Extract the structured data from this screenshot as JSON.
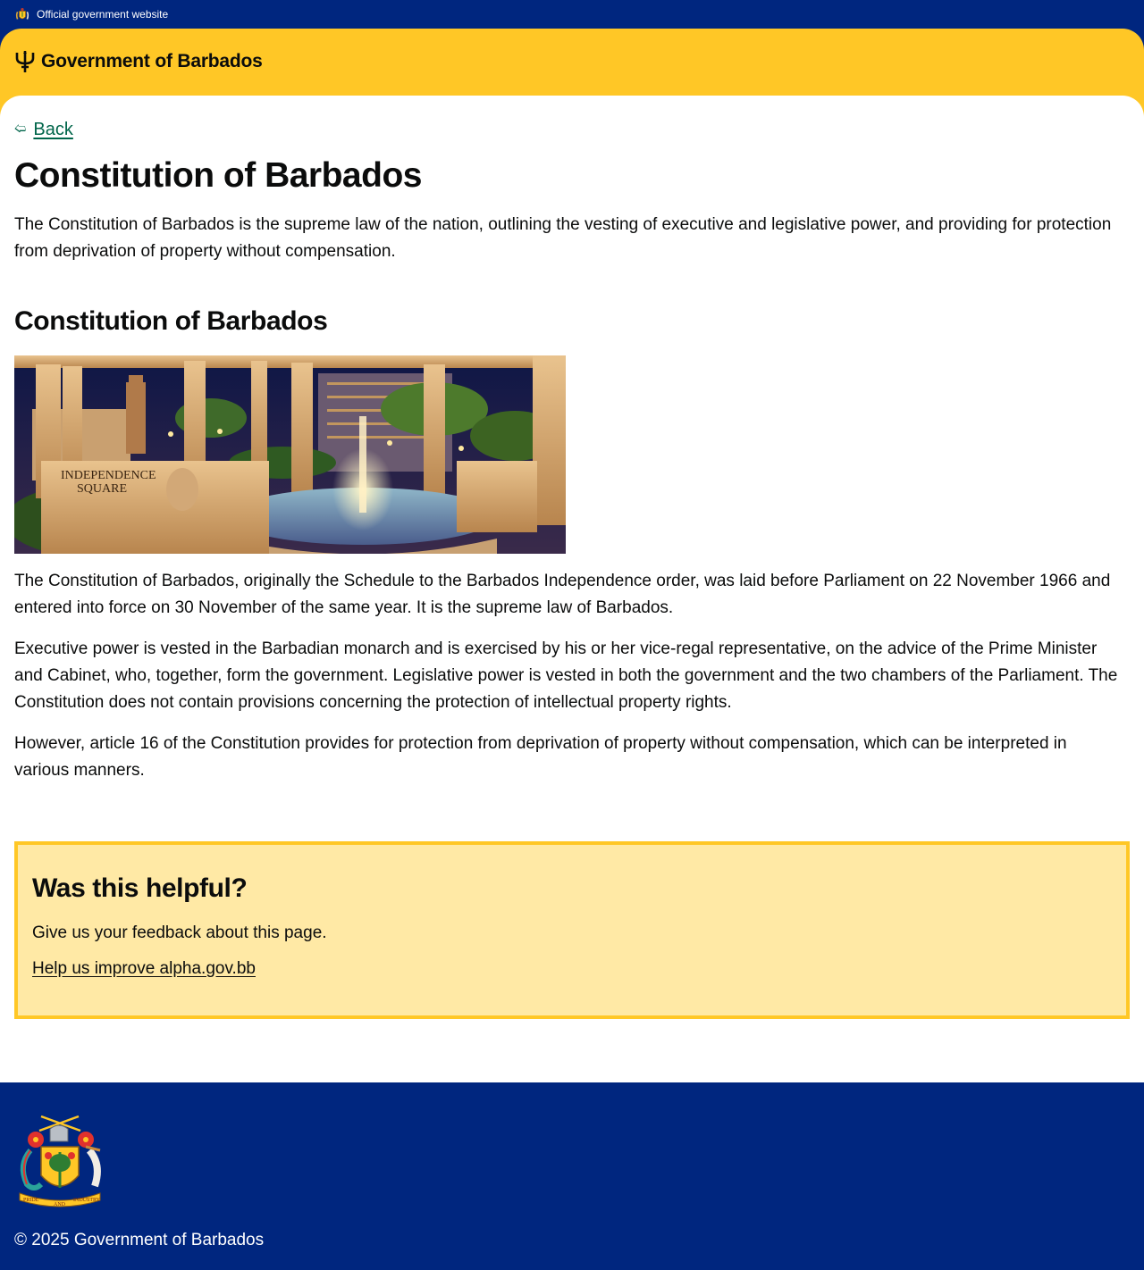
{
  "official_banner": {
    "text": "Official government website",
    "icon": "coat-of-arms-icon"
  },
  "header": {
    "brand": "Government of Barbados",
    "logo_icon": "trident-icon"
  },
  "nav": {
    "back_label": "Back",
    "back_icon": "arrow-left-icon"
  },
  "page": {
    "title": "Constitution of Barbados",
    "lead": "The Constitution of Barbados is the supreme law of the nation, outlining the vesting of executive and legislative power, and providing for protection from deprivation of property without compensation.",
    "section_title": "Constitution of Barbados",
    "image": {
      "sign_line1": "INDEPENDENCE",
      "sign_line2": "SQUARE"
    },
    "paragraphs": [
      "The Constitution of Barbados, originally the Schedule to the Barbados Independence order, was laid before Parliament on 22 November 1966 and entered into force on 30 November of the same year. It is the supreme law of Barbados.",
      "Executive power is vested in the Barbadian monarch and is exercised by his or her vice-regal representative, on the advice of the Prime Minister and Cabinet, who, together, form the government. Legislative power is vested in both the government and the two chambers of the Parliament. The Constitution does not contain provisions concerning the protection of intellectual property rights.",
      "However, article 16 of the Constitution provides for protection from deprivation of property without compensation, which can be interpreted in various manners."
    ]
  },
  "feedback": {
    "title": "Was this helpful?",
    "text": "Give us your feedback about this page.",
    "link": "Help us improve alpha.gov.bb"
  },
  "footer": {
    "copyright": "© 2025 Government of Barbados",
    "emblem_icon": "coat-of-arms-icon",
    "motto_left": "PRIDE",
    "motto_mid": "AND",
    "motto_right": "INDUSTRY"
  },
  "colors": {
    "navy": "#00267f",
    "yellow": "#ffc726",
    "feedback_bg": "#ffe9a5",
    "link_green": "#00654a"
  }
}
